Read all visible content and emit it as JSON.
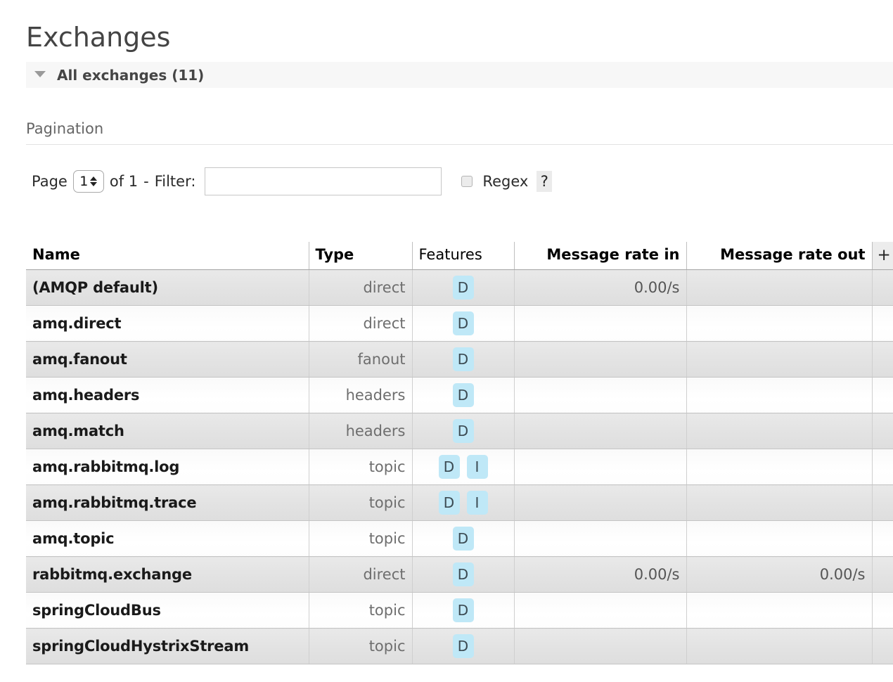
{
  "page": {
    "title": "Exchanges"
  },
  "section": {
    "toggle_icon": "triangle-down-icon",
    "label": "All exchanges (11)"
  },
  "pagination": {
    "heading": "Pagination",
    "page_label": "Page",
    "page_value": "1",
    "of_label": "of 1",
    "separator": "-",
    "filter_label": "Filter:",
    "filter_value": "",
    "filter_placeholder": "",
    "regex_label": "Regex",
    "regex_checked": false,
    "help_label": "?"
  },
  "table": {
    "columns": [
      {
        "key": "name",
        "label": "Name",
        "align": "left",
        "bold": true
      },
      {
        "key": "type",
        "label": "Type",
        "align": "left",
        "bold": true
      },
      {
        "key": "features",
        "label": "Features",
        "align": "left",
        "bold": false
      },
      {
        "key": "rate_in",
        "label": "Message rate in",
        "align": "right",
        "bold": true
      },
      {
        "key": "rate_out",
        "label": "Message rate out",
        "align": "right",
        "bold": true
      },
      {
        "key": "add",
        "label": "+",
        "align": "left",
        "bold": false
      }
    ],
    "rows": [
      {
        "name": "(AMQP default)",
        "type": "direct",
        "features": [
          "D"
        ],
        "rate_in": "0.00/s",
        "rate_out": ""
      },
      {
        "name": "amq.direct",
        "type": "direct",
        "features": [
          "D"
        ],
        "rate_in": "",
        "rate_out": ""
      },
      {
        "name": "amq.fanout",
        "type": "fanout",
        "features": [
          "D"
        ],
        "rate_in": "",
        "rate_out": ""
      },
      {
        "name": "amq.headers",
        "type": "headers",
        "features": [
          "D"
        ],
        "rate_in": "",
        "rate_out": ""
      },
      {
        "name": "amq.match",
        "type": "headers",
        "features": [
          "D"
        ],
        "rate_in": "",
        "rate_out": ""
      },
      {
        "name": "amq.rabbitmq.log",
        "type": "topic",
        "features": [
          "D",
          "I"
        ],
        "rate_in": "",
        "rate_out": ""
      },
      {
        "name": "amq.rabbitmq.trace",
        "type": "topic",
        "features": [
          "D",
          "I"
        ],
        "rate_in": "",
        "rate_out": ""
      },
      {
        "name": "amq.topic",
        "type": "topic",
        "features": [
          "D"
        ],
        "rate_in": "",
        "rate_out": ""
      },
      {
        "name": "rabbitmq.exchange",
        "type": "direct",
        "features": [
          "D"
        ],
        "rate_in": "0.00/s",
        "rate_out": "0.00/s"
      },
      {
        "name": "springCloudBus",
        "type": "topic",
        "features": [
          "D"
        ],
        "rate_in": "",
        "rate_out": ""
      },
      {
        "name": "springCloudHystrixStream",
        "type": "topic",
        "features": [
          "D"
        ],
        "rate_in": "",
        "rate_out": ""
      }
    ]
  },
  "colors": {
    "feature_badge_bg": "#bfe8f7",
    "feature_badge_fg": "#3b4a52",
    "row_odd_bg": "#e4e4e4",
    "row_even_bg": "#ffffff",
    "section_band_bg": "#f7f7f7",
    "title_fg": "#444444"
  }
}
